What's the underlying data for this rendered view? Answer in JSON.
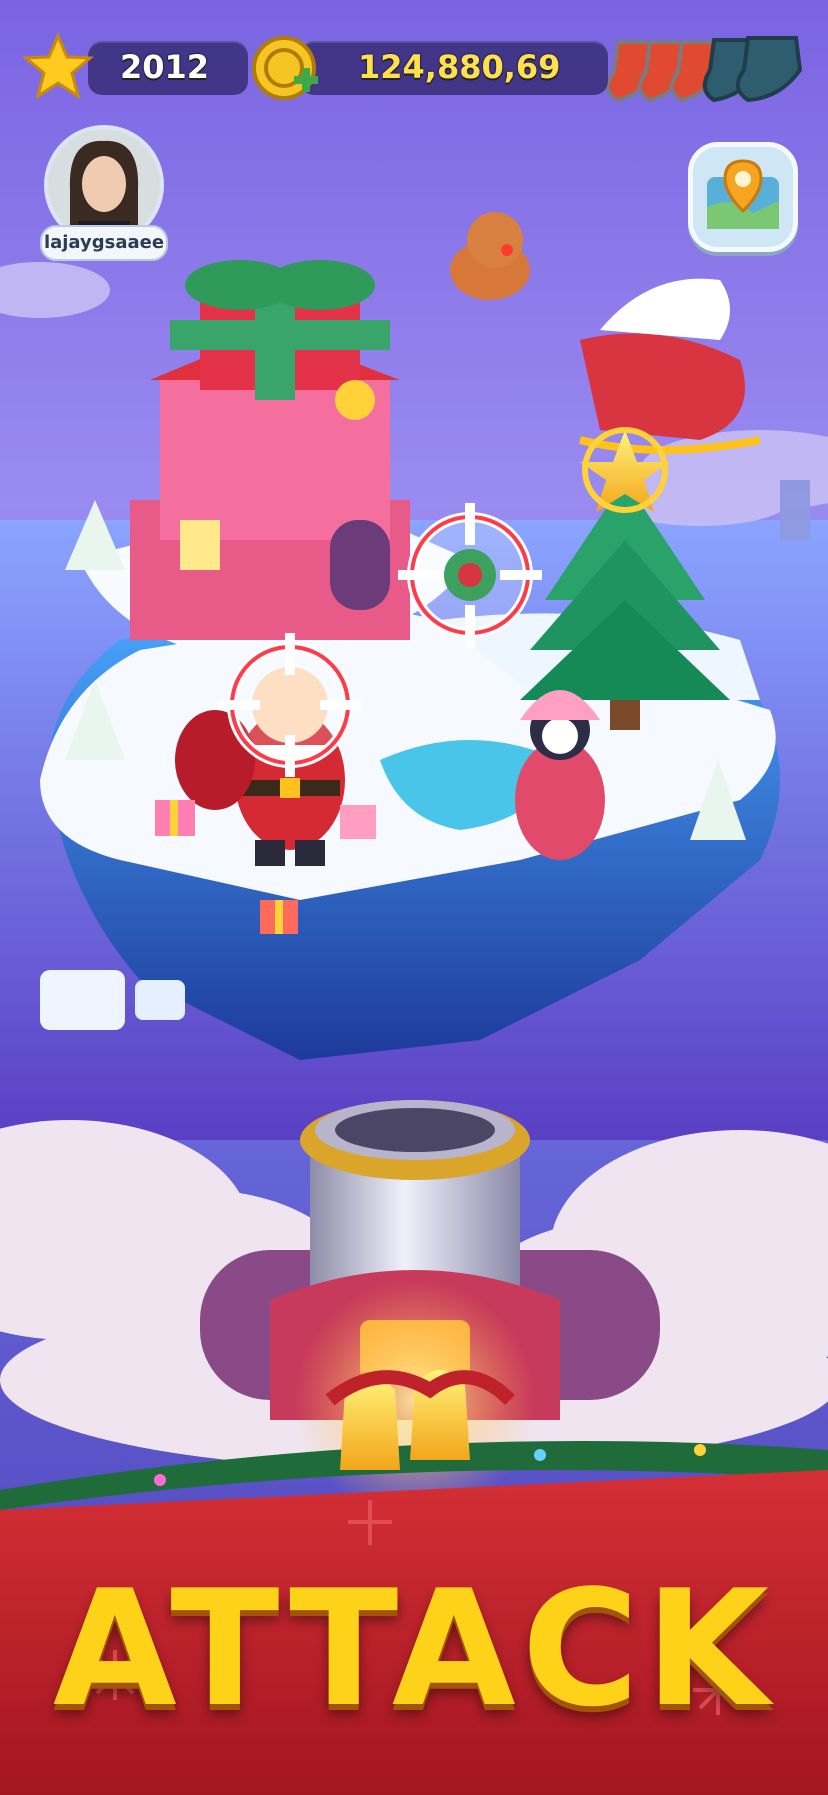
{
  "hud": {
    "stars": "2012",
    "coins": "124,880,69",
    "shields_total": 5,
    "shields_active": 3
  },
  "player": {
    "name": "lajaygsaaee"
  },
  "action": {
    "label": "ATTACK"
  },
  "targets": [
    "house-target",
    "tree-target",
    "santa-target"
  ],
  "colors": {
    "sky_top": "#7b66e3",
    "sea": "#5b6fd8",
    "gold": "#ffd21a",
    "red_banner": "#c8202a",
    "shield_active": "#e04a30",
    "shield_empty": "#2f5d70"
  },
  "icons": [
    "star-icon",
    "coin-icon",
    "shield-icon",
    "map-pin-icon",
    "crosshair-icon",
    "snowflake-icon"
  ]
}
